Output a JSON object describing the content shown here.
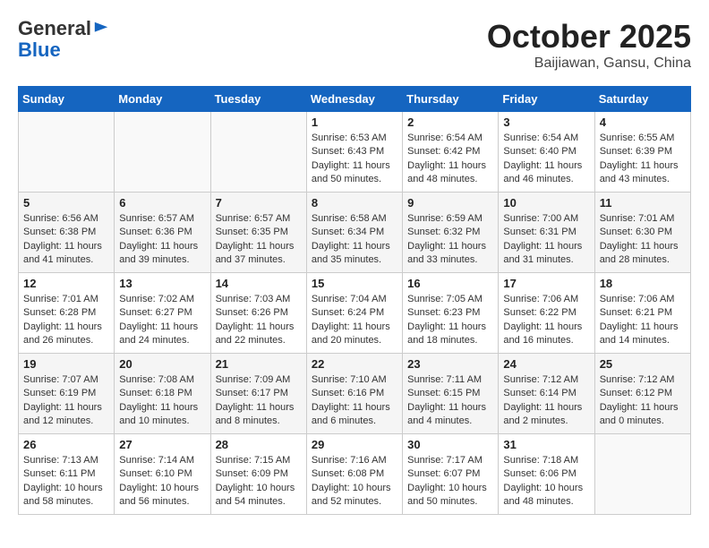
{
  "header": {
    "logo_general": "General",
    "logo_blue": "Blue",
    "month": "October 2025",
    "location": "Baijiawan, Gansu, China"
  },
  "days_of_week": [
    "Sunday",
    "Monday",
    "Tuesday",
    "Wednesday",
    "Thursday",
    "Friday",
    "Saturday"
  ],
  "weeks": [
    [
      {
        "day": null,
        "lines": []
      },
      {
        "day": null,
        "lines": []
      },
      {
        "day": null,
        "lines": []
      },
      {
        "day": "1",
        "lines": [
          "Sunrise: 6:53 AM",
          "Sunset: 6:43 PM",
          "Daylight: 11 hours",
          "and 50 minutes."
        ]
      },
      {
        "day": "2",
        "lines": [
          "Sunrise: 6:54 AM",
          "Sunset: 6:42 PM",
          "Daylight: 11 hours",
          "and 48 minutes."
        ]
      },
      {
        "day": "3",
        "lines": [
          "Sunrise: 6:54 AM",
          "Sunset: 6:40 PM",
          "Daylight: 11 hours",
          "and 46 minutes."
        ]
      },
      {
        "day": "4",
        "lines": [
          "Sunrise: 6:55 AM",
          "Sunset: 6:39 PM",
          "Daylight: 11 hours",
          "and 43 minutes."
        ]
      }
    ],
    [
      {
        "day": "5",
        "lines": [
          "Sunrise: 6:56 AM",
          "Sunset: 6:38 PM",
          "Daylight: 11 hours",
          "and 41 minutes."
        ]
      },
      {
        "day": "6",
        "lines": [
          "Sunrise: 6:57 AM",
          "Sunset: 6:36 PM",
          "Daylight: 11 hours",
          "and 39 minutes."
        ]
      },
      {
        "day": "7",
        "lines": [
          "Sunrise: 6:57 AM",
          "Sunset: 6:35 PM",
          "Daylight: 11 hours",
          "and 37 minutes."
        ]
      },
      {
        "day": "8",
        "lines": [
          "Sunrise: 6:58 AM",
          "Sunset: 6:34 PM",
          "Daylight: 11 hours",
          "and 35 minutes."
        ]
      },
      {
        "day": "9",
        "lines": [
          "Sunrise: 6:59 AM",
          "Sunset: 6:32 PM",
          "Daylight: 11 hours",
          "and 33 minutes."
        ]
      },
      {
        "day": "10",
        "lines": [
          "Sunrise: 7:00 AM",
          "Sunset: 6:31 PM",
          "Daylight: 11 hours",
          "and 31 minutes."
        ]
      },
      {
        "day": "11",
        "lines": [
          "Sunrise: 7:01 AM",
          "Sunset: 6:30 PM",
          "Daylight: 11 hours",
          "and 28 minutes."
        ]
      }
    ],
    [
      {
        "day": "12",
        "lines": [
          "Sunrise: 7:01 AM",
          "Sunset: 6:28 PM",
          "Daylight: 11 hours",
          "and 26 minutes."
        ]
      },
      {
        "day": "13",
        "lines": [
          "Sunrise: 7:02 AM",
          "Sunset: 6:27 PM",
          "Daylight: 11 hours",
          "and 24 minutes."
        ]
      },
      {
        "day": "14",
        "lines": [
          "Sunrise: 7:03 AM",
          "Sunset: 6:26 PM",
          "Daylight: 11 hours",
          "and 22 minutes."
        ]
      },
      {
        "day": "15",
        "lines": [
          "Sunrise: 7:04 AM",
          "Sunset: 6:24 PM",
          "Daylight: 11 hours",
          "and 20 minutes."
        ]
      },
      {
        "day": "16",
        "lines": [
          "Sunrise: 7:05 AM",
          "Sunset: 6:23 PM",
          "Daylight: 11 hours",
          "and 18 minutes."
        ]
      },
      {
        "day": "17",
        "lines": [
          "Sunrise: 7:06 AM",
          "Sunset: 6:22 PM",
          "Daylight: 11 hours",
          "and 16 minutes."
        ]
      },
      {
        "day": "18",
        "lines": [
          "Sunrise: 7:06 AM",
          "Sunset: 6:21 PM",
          "Daylight: 11 hours",
          "and 14 minutes."
        ]
      }
    ],
    [
      {
        "day": "19",
        "lines": [
          "Sunrise: 7:07 AM",
          "Sunset: 6:19 PM",
          "Daylight: 11 hours",
          "and 12 minutes."
        ]
      },
      {
        "day": "20",
        "lines": [
          "Sunrise: 7:08 AM",
          "Sunset: 6:18 PM",
          "Daylight: 11 hours",
          "and 10 minutes."
        ]
      },
      {
        "day": "21",
        "lines": [
          "Sunrise: 7:09 AM",
          "Sunset: 6:17 PM",
          "Daylight: 11 hours",
          "and 8 minutes."
        ]
      },
      {
        "day": "22",
        "lines": [
          "Sunrise: 7:10 AM",
          "Sunset: 6:16 PM",
          "Daylight: 11 hours",
          "and 6 minutes."
        ]
      },
      {
        "day": "23",
        "lines": [
          "Sunrise: 7:11 AM",
          "Sunset: 6:15 PM",
          "Daylight: 11 hours",
          "and 4 minutes."
        ]
      },
      {
        "day": "24",
        "lines": [
          "Sunrise: 7:12 AM",
          "Sunset: 6:14 PM",
          "Daylight: 11 hours",
          "and 2 minutes."
        ]
      },
      {
        "day": "25",
        "lines": [
          "Sunrise: 7:12 AM",
          "Sunset: 6:12 PM",
          "Daylight: 11 hours",
          "and 0 minutes."
        ]
      }
    ],
    [
      {
        "day": "26",
        "lines": [
          "Sunrise: 7:13 AM",
          "Sunset: 6:11 PM",
          "Daylight: 10 hours",
          "and 58 minutes."
        ]
      },
      {
        "day": "27",
        "lines": [
          "Sunrise: 7:14 AM",
          "Sunset: 6:10 PM",
          "Daylight: 10 hours",
          "and 56 minutes."
        ]
      },
      {
        "day": "28",
        "lines": [
          "Sunrise: 7:15 AM",
          "Sunset: 6:09 PM",
          "Daylight: 10 hours",
          "and 54 minutes."
        ]
      },
      {
        "day": "29",
        "lines": [
          "Sunrise: 7:16 AM",
          "Sunset: 6:08 PM",
          "Daylight: 10 hours",
          "and 52 minutes."
        ]
      },
      {
        "day": "30",
        "lines": [
          "Sunrise: 7:17 AM",
          "Sunset: 6:07 PM",
          "Daylight: 10 hours",
          "and 50 minutes."
        ]
      },
      {
        "day": "31",
        "lines": [
          "Sunrise: 7:18 AM",
          "Sunset: 6:06 PM",
          "Daylight: 10 hours",
          "and 48 minutes."
        ]
      },
      {
        "day": null,
        "lines": []
      }
    ]
  ]
}
